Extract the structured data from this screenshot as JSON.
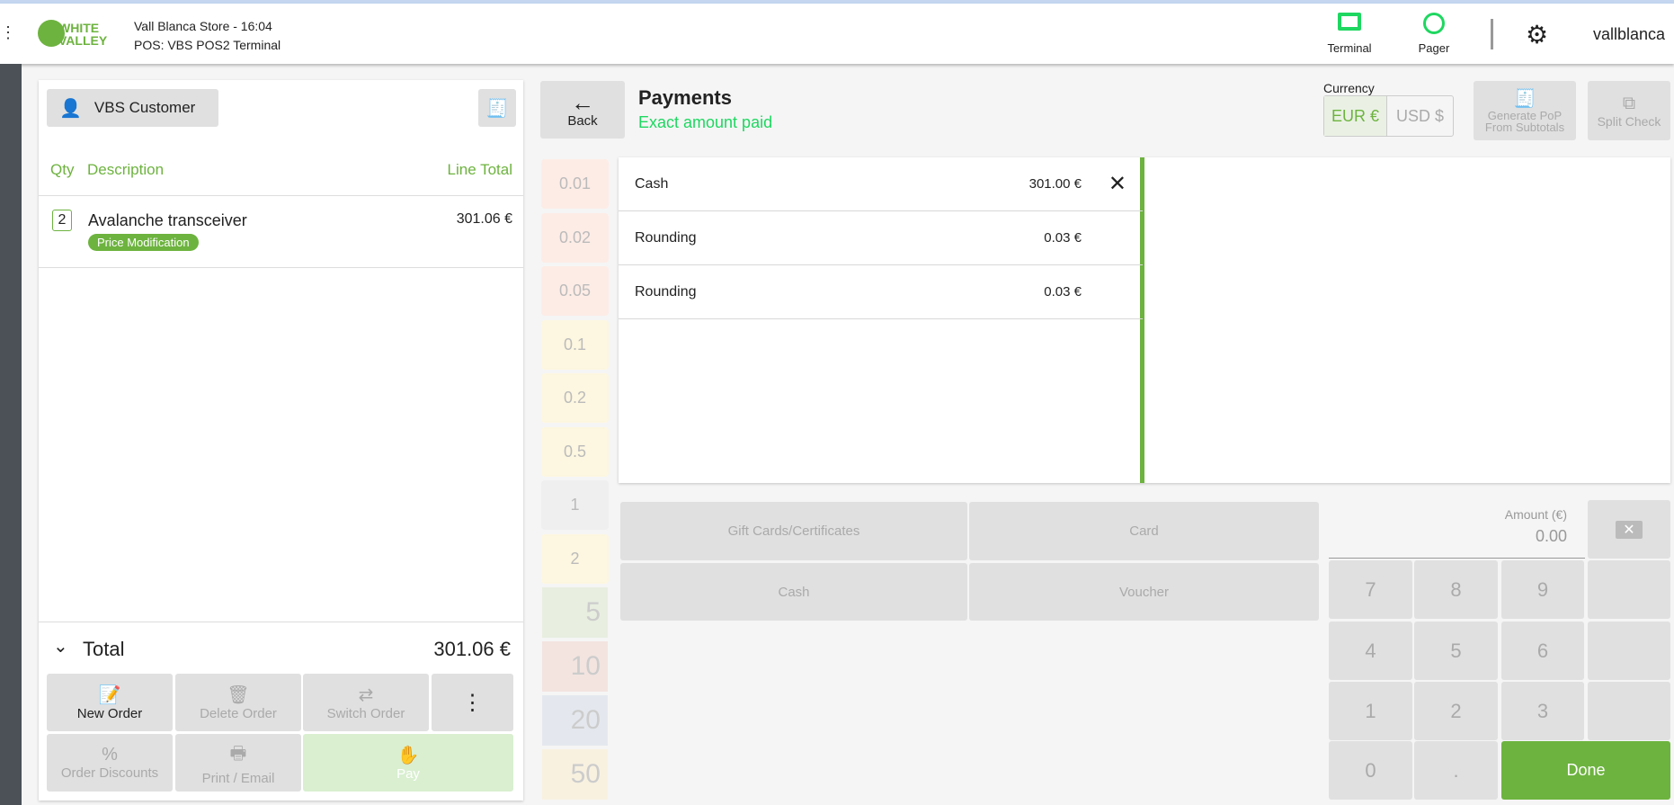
{
  "header": {
    "brand_line1": "WHITE",
    "brand_line2": "VALLEY",
    "store": "Vall Blanca Store - 16:04",
    "pos": "POS: VBS POS2 Terminal",
    "terminal": "Terminal",
    "pager": "Pager",
    "user": "vallblanca"
  },
  "order": {
    "customer": "VBS Customer",
    "col_qty": "Qty",
    "col_desc": "Description",
    "col_total": "Line Total",
    "items": [
      {
        "qty": "2",
        "name": "Avalanche transceiver",
        "badge": "Price Modification",
        "total": "301.06 €"
      }
    ],
    "total_label": "Total",
    "total_value": "301.06 €",
    "actions": {
      "new_order": "New Order",
      "delete_order": "Delete Order",
      "switch_order": "Switch Order",
      "order_discounts": "Order Discounts",
      "print_email": "Print / Email",
      "pay": "Pay"
    }
  },
  "payments": {
    "back": "Back",
    "title": "Payments",
    "status": "Exact amount paid",
    "currency_label": "Currency",
    "currencies": [
      "EUR €",
      "USD $"
    ],
    "generate_pop": "Generate PoP From Subtotals",
    "split_check": "Split Check",
    "lines": [
      {
        "method": "Cash",
        "amount": "301.00 €"
      },
      {
        "method": "Rounding",
        "amount": "0.03 €"
      },
      {
        "method": "Rounding",
        "amount": "0.03 €"
      }
    ],
    "coins": [
      "0.01",
      "0.02",
      "0.05",
      "0.1",
      "0.2",
      "0.5",
      "1",
      "2"
    ],
    "notes": [
      "5",
      "10",
      "20",
      "50"
    ],
    "methods": [
      "Gift Cards/Certificates",
      "Card",
      "Cash",
      "Voucher"
    ],
    "amount_label": "Amount (€)",
    "amount_value": "0.00",
    "keys": [
      "7",
      "8",
      "9",
      "4",
      "5",
      "6",
      "1",
      "2",
      "3",
      "0",
      "."
    ],
    "done": "Done"
  },
  "colors": {
    "accent": "#6db33f",
    "status": "#1ed760"
  }
}
